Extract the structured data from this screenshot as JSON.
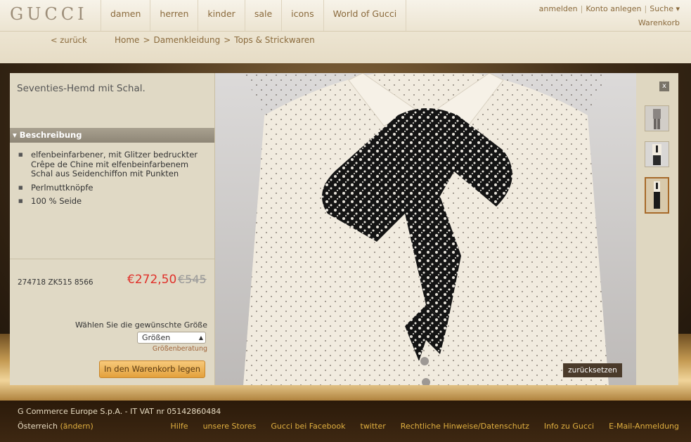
{
  "header": {
    "logo": "GUCCI",
    "nav": [
      "damen",
      "herren",
      "kinder",
      "sale",
      "icons",
      "World of Gucci"
    ],
    "account": {
      "login": "anmelden",
      "register": "Konto anlegen",
      "search": "Suche ▾"
    },
    "cart": "Warenkorb"
  },
  "subheader": {
    "back": "< zurück",
    "breadcrumb": [
      "Home",
      ">",
      "Damenkleidung",
      ">",
      "Tops & Strickwaren"
    ]
  },
  "product": {
    "title": "Seventies-Hemd mit Schal.",
    "description_header": "▾ Beschreibung",
    "description": [
      "elfenbeinfarbener, mit Glitzer bedruckter Crêpe de Chine mit elfenbeinfarbenem Schal aus Seidenchiffon mit Punkten",
      "Perlmuttknöpfe",
      "100 % Seide"
    ],
    "sku": "274718 ZK515 8566",
    "price": "€272,50",
    "old_price": "€545",
    "size_label": "Wählen Sie die gewünschte Größe",
    "size_select": "Größen",
    "size_guide": "Größenberatung",
    "cart_button": "In den Warenkorb legen"
  },
  "viewer": {
    "reset": "zurücksetzen",
    "close": "x"
  },
  "footer": {
    "company": "G Commerce Europe S.p.A. - IT VAT nr 05142860484",
    "country": "Österreich",
    "country_change": "(ändern)",
    "links": [
      "Hilfe",
      "unsere Stores",
      "Gucci bei Facebook",
      "twitter",
      "Rechtliche Hinweise/Datenschutz",
      "Info zu Gucci",
      "E-Mail-Anmeldung"
    ]
  }
}
